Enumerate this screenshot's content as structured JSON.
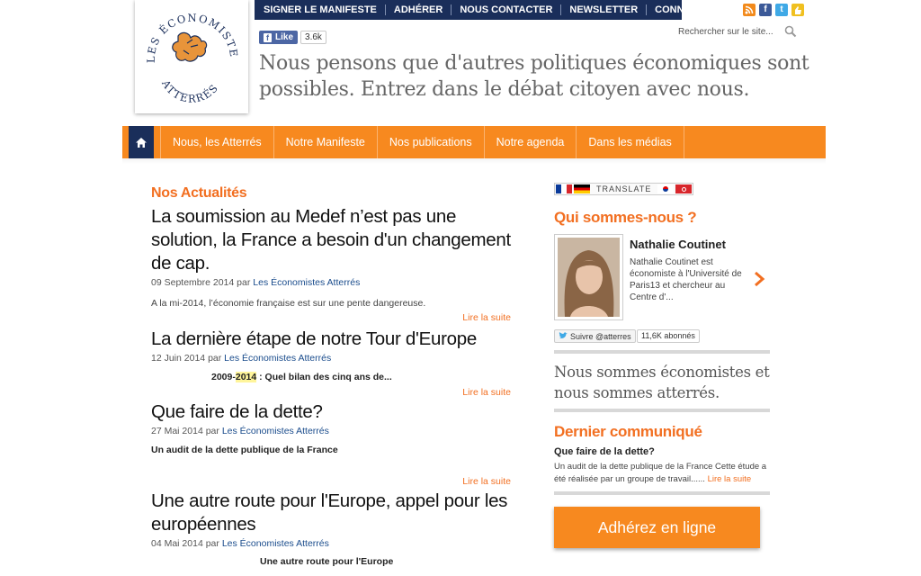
{
  "colors": {
    "navy": "#1a2e5a",
    "orange": "#f7891f",
    "orange_text": "#f26f21",
    "link_blue": "#1a4c8c"
  },
  "topnav": {
    "links": [
      "SIGNER LE MANIFESTE",
      "ADHÉRER",
      "NOUS CONTACTER",
      "NEWSLETTER",
      "CONNEXION"
    ],
    "social_icons": [
      "rss-icon",
      "facebook-icon",
      "twitter-icon",
      "like-icon"
    ]
  },
  "logo": {
    "line1": "LES ÉCONOMISTES",
    "line2": "ATTERRÉS"
  },
  "facebook": {
    "like_label": "Like",
    "count": "3.6k"
  },
  "search": {
    "placeholder": "Rechercher sur le site..."
  },
  "tagline": "Nous pensons que d'autres politiques économiques sont possibles. Entrez dans le débat citoyen avec nous.",
  "mainnav": {
    "items": [
      "Nous, les Atterrés",
      "Notre Manifeste",
      "Nos publications",
      "Notre agenda",
      "Dans les médias"
    ]
  },
  "news": {
    "section_title": "Nos Actualités",
    "read_more": "Lire la suite",
    "by": "par",
    "articles": [
      {
        "title": "La soumission au Medef n’est pas une solution, la France a besoin d'un changement de cap.",
        "date": "09 Septembre 2014",
        "author": "Les Économistes Atterrés",
        "excerpt": "A la mi-2014, l’économie française est sur une pente dangereuse."
      },
      {
        "title": "La dernière étape de notre Tour d'Europe",
        "date": "12 Juin 2014",
        "author": "Les Économistes Atterrés",
        "excerpt_pre": "2009-",
        "excerpt_hl": "2014",
        "excerpt_post": " : Quel bilan des cinq ans de..."
      },
      {
        "title": "Que faire de la dette?",
        "date": "27 Mai 2014",
        "author": "Les Économistes Atterrés",
        "excerpt": "Un audit de la dette publique de la France"
      },
      {
        "title": "Une autre route pour l'Europe, appel pour les européennes",
        "date": "04 Mai 2014",
        "author": "Les Économistes Atterrés",
        "excerpt": "Une autre route pour l'Europe"
      }
    ]
  },
  "sidebar": {
    "translate_label": "TRANSLATE",
    "who_title": "Qui sommes-nous ?",
    "person": {
      "name": "Nathalie Coutinet",
      "description": "Nathalie Coutinet est économiste à l'Université de Paris13 et chercheur au Centre d'..."
    },
    "twitter": {
      "follow_label": "Suivre @atterres",
      "followers": "11,6K abonnés"
    },
    "quote": "Nous sommes économistes et nous sommes atterrés.",
    "communique": {
      "title": "Dernier communiqué",
      "headline": "Que faire de la dette?",
      "text": "Un audit de la dette publique de la France Cette étude a été réalisée par un groupe de travail......",
      "read_more": "Lire la suite"
    },
    "join_button": "Adhérez en ligne"
  }
}
